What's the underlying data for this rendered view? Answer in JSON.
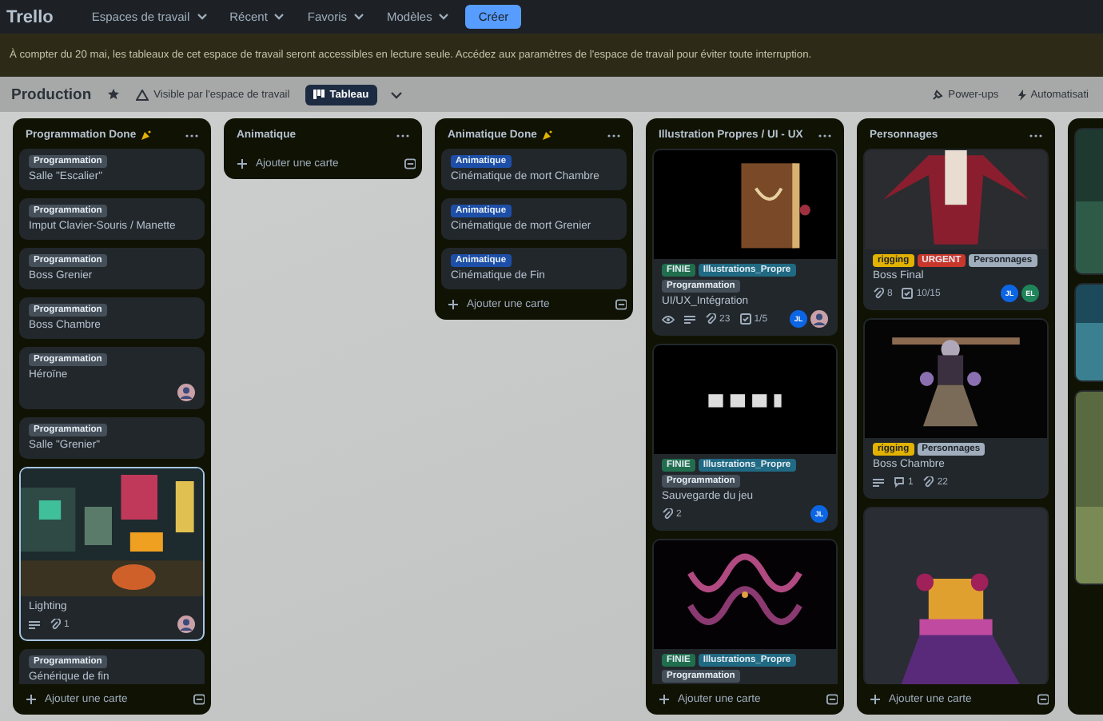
{
  "topnav": {
    "logo": "Trello",
    "menus": [
      "Espaces de travail",
      "Récent",
      "Favoris",
      "Modèles"
    ],
    "create": "Créer"
  },
  "banner": "À compter du 20 mai, les tableaux de cet espace de travail seront accessibles en lecture seule. Accédez aux paramètres de l'espace de travail pour éviter toute interruption.",
  "board_header": {
    "title": "Production",
    "visibility": "Visible par l'espace de travail",
    "view": "Tableau",
    "actions": [
      "Power-ups",
      "Automatisati"
    ]
  },
  "lists": [
    {
      "title": "Programmation Done",
      "celebrate": true,
      "add_card": "Ajouter une carte",
      "cards": [
        {
          "selected": false,
          "labels": [
            {
              "text": "Programmation",
              "color": "#454f59"
            }
          ],
          "title": "Salle \"Escalier\""
        },
        {
          "selected": false,
          "labels": [
            {
              "text": "Programmation",
              "color": "#454f59"
            }
          ],
          "title": "Imput Clavier-Souris / Manette"
        },
        {
          "selected": false,
          "labels": [
            {
              "text": "Programmation",
              "color": "#454f59"
            }
          ],
          "title": "Boss Grenier"
        },
        {
          "selected": false,
          "labels": [
            {
              "text": "Programmation",
              "color": "#454f59"
            }
          ],
          "title": "Boss Chambre"
        },
        {
          "selected": false,
          "labels": [
            {
              "text": "Programmation",
              "color": "#454f59"
            }
          ],
          "title": "Héroïne",
          "members": [
            {
              "kind": "avatar"
            }
          ]
        },
        {
          "selected": false,
          "labels": [
            {
              "text": "Programmation",
              "color": "#454f59"
            }
          ],
          "title": "Salle \"Grenier\""
        },
        {
          "selected": true,
          "cover": {
            "kind": "picture"
          },
          "title": "Lighting",
          "badges": [
            {
              "kind": "description"
            },
            {
              "kind": "attachments",
              "text": "1"
            }
          ],
          "members": [
            {
              "kind": "avatar"
            }
          ]
        },
        {
          "selected": false,
          "labels": [
            {
              "text": "Programmation",
              "color": "#454f59"
            }
          ],
          "title": "Générique de fin"
        }
      ]
    },
    {
      "title": "Animatique",
      "celebrate": false,
      "add_card": "Ajouter une carte"
    },
    {
      "title": "Animatique Done",
      "celebrate": true,
      "add_card": "Ajouter une carte",
      "cards": [
        {
          "selected": false,
          "labels": [
            {
              "text": "Animatique",
              "color": "#1d4fa8"
            }
          ],
          "title": "Cinématique de mort Chambre"
        },
        {
          "selected": false,
          "labels": [
            {
              "text": "Animatique",
              "color": "#1d4fa8"
            }
          ],
          "title": "Cinématique de mort Grenier"
        },
        {
          "selected": false,
          "labels": [
            {
              "text": "Animatique",
              "color": "#1d4fa8"
            }
          ],
          "title": "Cinématique de Fin"
        }
      ]
    },
    {
      "title": "Illustration Propres / UI - UX",
      "celebrate": false,
      "add_card": "Ajouter une carte",
      "cards": [
        {
          "selected": false,
          "cover": {
            "kind": "picture"
          },
          "labels": [
            {
              "text": "FINIE",
              "color": "#216e4e"
            },
            {
              "text": "Illustrations_Propre",
              "color": "#206a83"
            },
            {
              "text": "Programmation",
              "color": "#454f59"
            }
          ],
          "title": "UI/UX_Intégration",
          "badges": [
            {
              "kind": "watch"
            },
            {
              "kind": "description"
            },
            {
              "kind": "attachments",
              "text": "23"
            },
            {
              "kind": "checklist",
              "text": "1/5"
            }
          ],
          "members": [
            {
              "kind": "initials",
              "initials": "JL",
              "color": "#0c66e4"
            },
            {
              "kind": "avatar"
            }
          ]
        },
        {
          "selected": false,
          "cover": {
            "kind": "picture"
          },
          "labels": [
            {
              "text": "FINIE",
              "color": "#216e4e"
            },
            {
              "text": "Illustrations_Propre",
              "color": "#206a83"
            },
            {
              "text": "Programmation",
              "color": "#454f59"
            }
          ],
          "title": "Sauvegarde du jeu",
          "badges": [
            {
              "kind": "attachments",
              "text": "2"
            }
          ],
          "members": [
            {
              "kind": "initials",
              "initials": "JL",
              "color": "#0c66e4"
            }
          ]
        },
        {
          "selected": false,
          "cover": {
            "kind": "picture"
          },
          "labels": [
            {
              "text": "FINIE",
              "color": "#216e4e"
            },
            {
              "text": "Illustrations_Propre",
              "color": "#206a83"
            },
            {
              "text": "Programmation",
              "color": "#454f59"
            }
          ]
        }
      ]
    },
    {
      "title": "Personnages",
      "celebrate": false,
      "add_card": "Ajouter une carte",
      "cards": [
        {
          "selected": false,
          "cover": {
            "kind": "picture"
          },
          "labels": [
            {
              "text": "rigging",
              "color": "#e2b203"
            },
            {
              "text": "URGENT",
              "color": "#c9372c"
            },
            {
              "text": "Personnages",
              "color": "#9fadbc"
            }
          ],
          "title": "Boss Final",
          "badges": [
            {
              "kind": "attachments",
              "text": "8"
            },
            {
              "kind": "checklist",
              "text": "10/15"
            }
          ],
          "members": [
            {
              "kind": "initials",
              "initials": "JL",
              "color": "#0c66e4"
            },
            {
              "kind": "initials",
              "initials": "EL",
              "color": "#1f845a"
            }
          ]
        },
        {
          "selected": false,
          "cover": {
            "kind": "picture"
          },
          "labels": [
            {
              "text": "rigging",
              "color": "#e2b203"
            },
            {
              "text": "Personnages",
              "color": "#9fadbc"
            }
          ],
          "title": "Boss Chambre",
          "badges": [
            {
              "kind": "description"
            },
            {
              "kind": "comments",
              "text": "1"
            },
            {
              "kind": "attachments",
              "text": "22"
            }
          ]
        },
        {
          "selected": false,
          "cover": {
            "kind": "picture"
          }
        }
      ]
    },
    {
      "cards": [
        {
          "selected": false,
          "cover": {
            "kind": "picture"
          }
        },
        {
          "selected": false,
          "cover": {
            "kind": "picture"
          }
        },
        {
          "selected": false,
          "cover": {
            "kind": "picture"
          }
        }
      ]
    }
  ]
}
